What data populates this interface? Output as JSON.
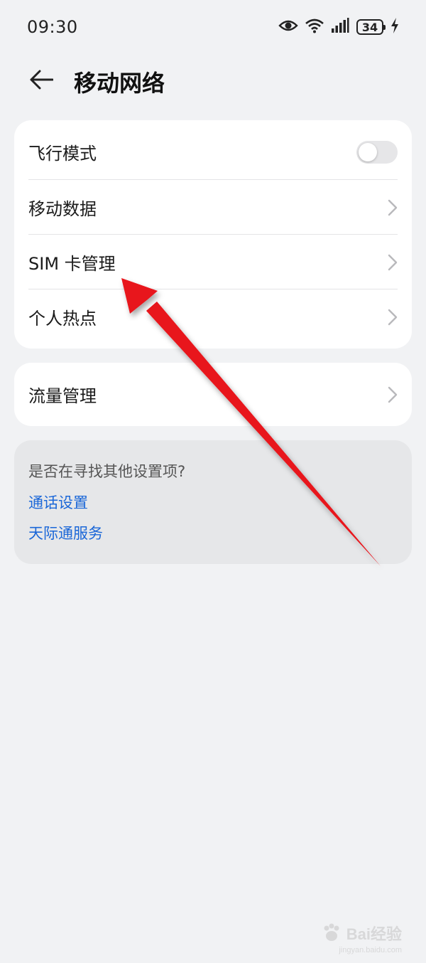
{
  "status_bar": {
    "time": "09:30",
    "battery": "34",
    "icons": [
      "eye-icon",
      "wifi-icon",
      "signal-icon",
      "battery-icon",
      "charging-icon"
    ]
  },
  "header": {
    "title": "移动网络",
    "back_icon": "back-arrow-icon"
  },
  "settings_card": {
    "items": [
      {
        "label": "飞行模式",
        "control": "toggle",
        "toggle_on": false
      },
      {
        "label": "移动数据",
        "control": "chevron"
      },
      {
        "label": "SIM 卡管理",
        "control": "chevron"
      },
      {
        "label": "个人热点",
        "control": "chevron"
      }
    ]
  },
  "traffic_card": {
    "label": "流量管理",
    "control": "chevron"
  },
  "suggestions": {
    "title": "是否在寻找其他设置项?",
    "links": [
      "通话设置",
      "天际通服务"
    ]
  },
  "colors": {
    "background": "#f1f2f4",
    "card": "#ffffff",
    "link": "#1b67d8",
    "annotation_arrow": "#e8121a"
  },
  "watermark": {
    "text": "Bai经验",
    "sub": "jingyan.baidu.com"
  }
}
